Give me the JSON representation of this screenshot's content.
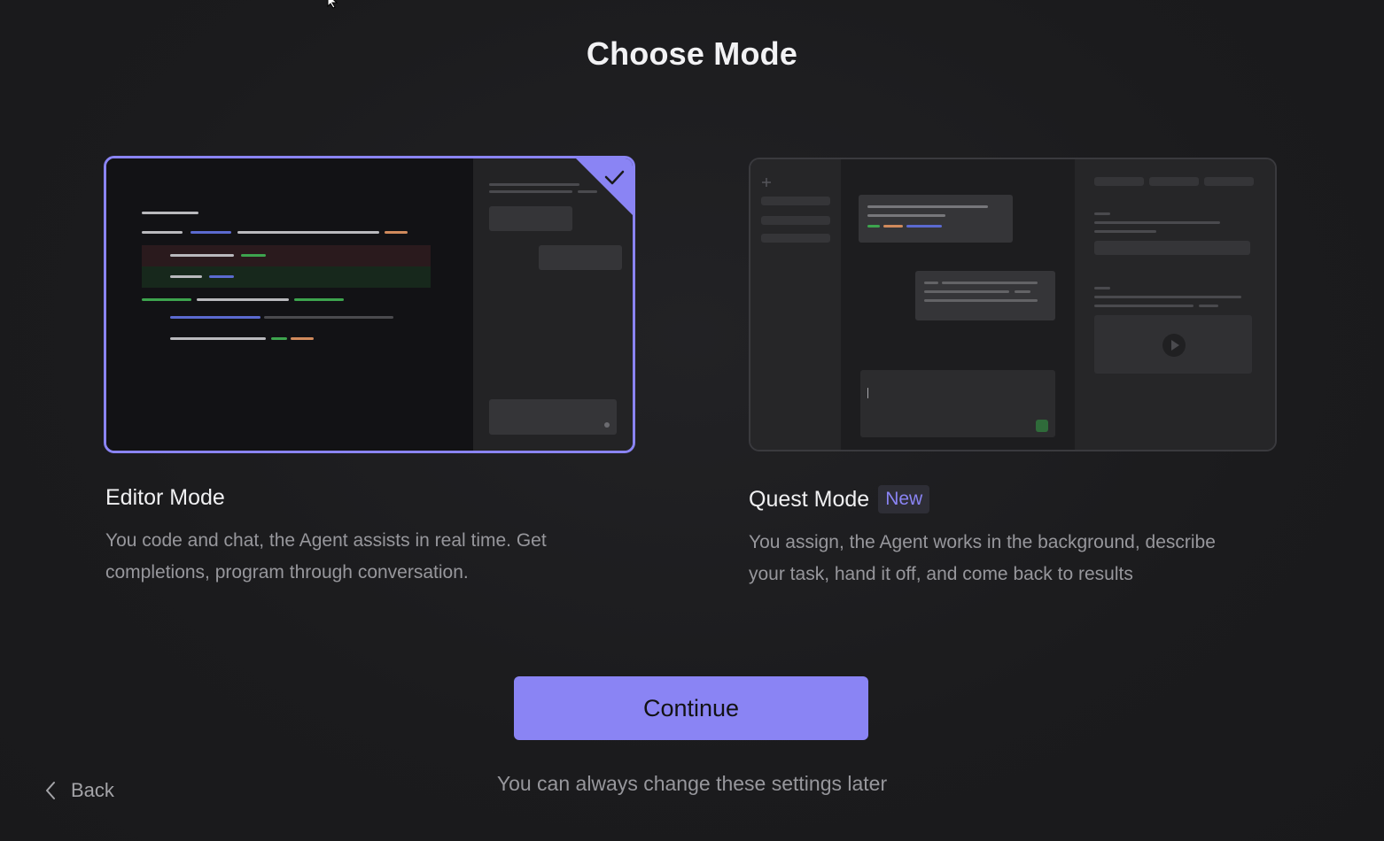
{
  "page": {
    "title": "Choose Mode"
  },
  "modes": [
    {
      "id": "editor",
      "title": "Editor Mode",
      "description_line1": "You code and chat, the Agent assists in real time. Get",
      "description_line2": "completions, program through conversation.",
      "selected": true,
      "preview_icon": "check-icon"
    },
    {
      "id": "quest",
      "title": "Quest Mode",
      "badge": "New",
      "description_line1": "You assign, the Agent works in the background, describe",
      "description_line2": "your task, hand it off, and come back to results",
      "selected": false,
      "preview_icon": "play-icon"
    }
  ],
  "actions": {
    "continue_label": "Continue",
    "hint": "You can always change these settings later",
    "back_label": "Back"
  },
  "colors": {
    "accent": "#8a84f4",
    "background": "#1c1c1e"
  }
}
